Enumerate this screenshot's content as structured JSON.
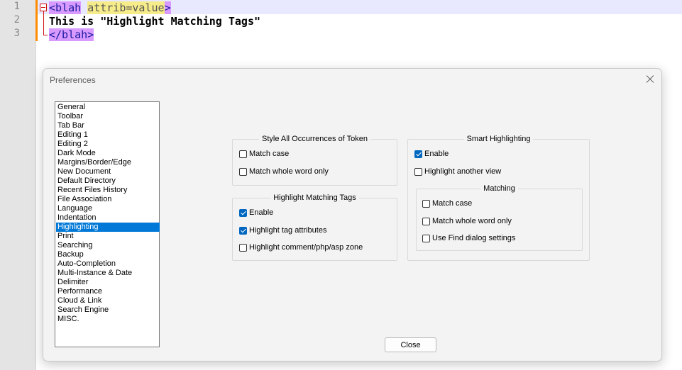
{
  "editor": {
    "line_numbers": [
      "1",
      "2",
      "3"
    ],
    "line1": {
      "tag_open": "<blah",
      "space": " ",
      "attr": "attrib=value",
      "tag_close": ">"
    },
    "line2": {
      "text": "This is \"Highlight Matching Tags\""
    },
    "line3": {
      "tag": "</blah>"
    }
  },
  "dialog": {
    "title": "Preferences",
    "close_label": "Close",
    "categories": [
      "General",
      "Toolbar",
      "Tab Bar",
      "Editing 1",
      "Editing 2",
      "Dark Mode",
      "Margins/Border/Edge",
      "New Document",
      "Default Directory",
      "Recent Files History",
      "File Association",
      "Language",
      "Indentation",
      "Highlighting",
      "Print",
      "Searching",
      "Backup",
      "Auto-Completion",
      "Multi-Instance & Date",
      "Delimiter",
      "Performance",
      "Cloud & Link",
      "Search Engine",
      "MISC."
    ],
    "selected_category": "Highlighting",
    "style_all": {
      "title": "Style All Occurrences of Token",
      "match_case": {
        "label": "Match case",
        "checked": false
      },
      "match_whole_word": {
        "label": "Match whole word only",
        "checked": false
      }
    },
    "matching_tags": {
      "title": "Highlight Matching Tags",
      "enable": {
        "label": "Enable",
        "checked": true
      },
      "tag_attributes": {
        "label": "Highlight tag attributes",
        "checked": true
      },
      "comment_zone": {
        "label": "Highlight comment/php/asp zone",
        "checked": false
      }
    },
    "smart": {
      "title": "Smart Highlighting",
      "enable": {
        "label": "Enable",
        "checked": true
      },
      "another_view": {
        "label": "Highlight another view",
        "checked": false
      },
      "matching": {
        "title": "Matching",
        "match_case": {
          "label": "Match case",
          "checked": false
        },
        "match_whole_word": {
          "label": "Match whole word only",
          "checked": false
        },
        "use_find_dialog": {
          "label": "Use Find dialog settings",
          "checked": false
        }
      }
    }
  },
  "colors": {
    "accent": "#0078d7",
    "checkbox_checked": "#0067c0",
    "tag_highlight": "#d89aff",
    "attr_highlight": "#f7ec8a",
    "current_line": "#e8e8ff",
    "change_marker": "#ff8c00"
  }
}
